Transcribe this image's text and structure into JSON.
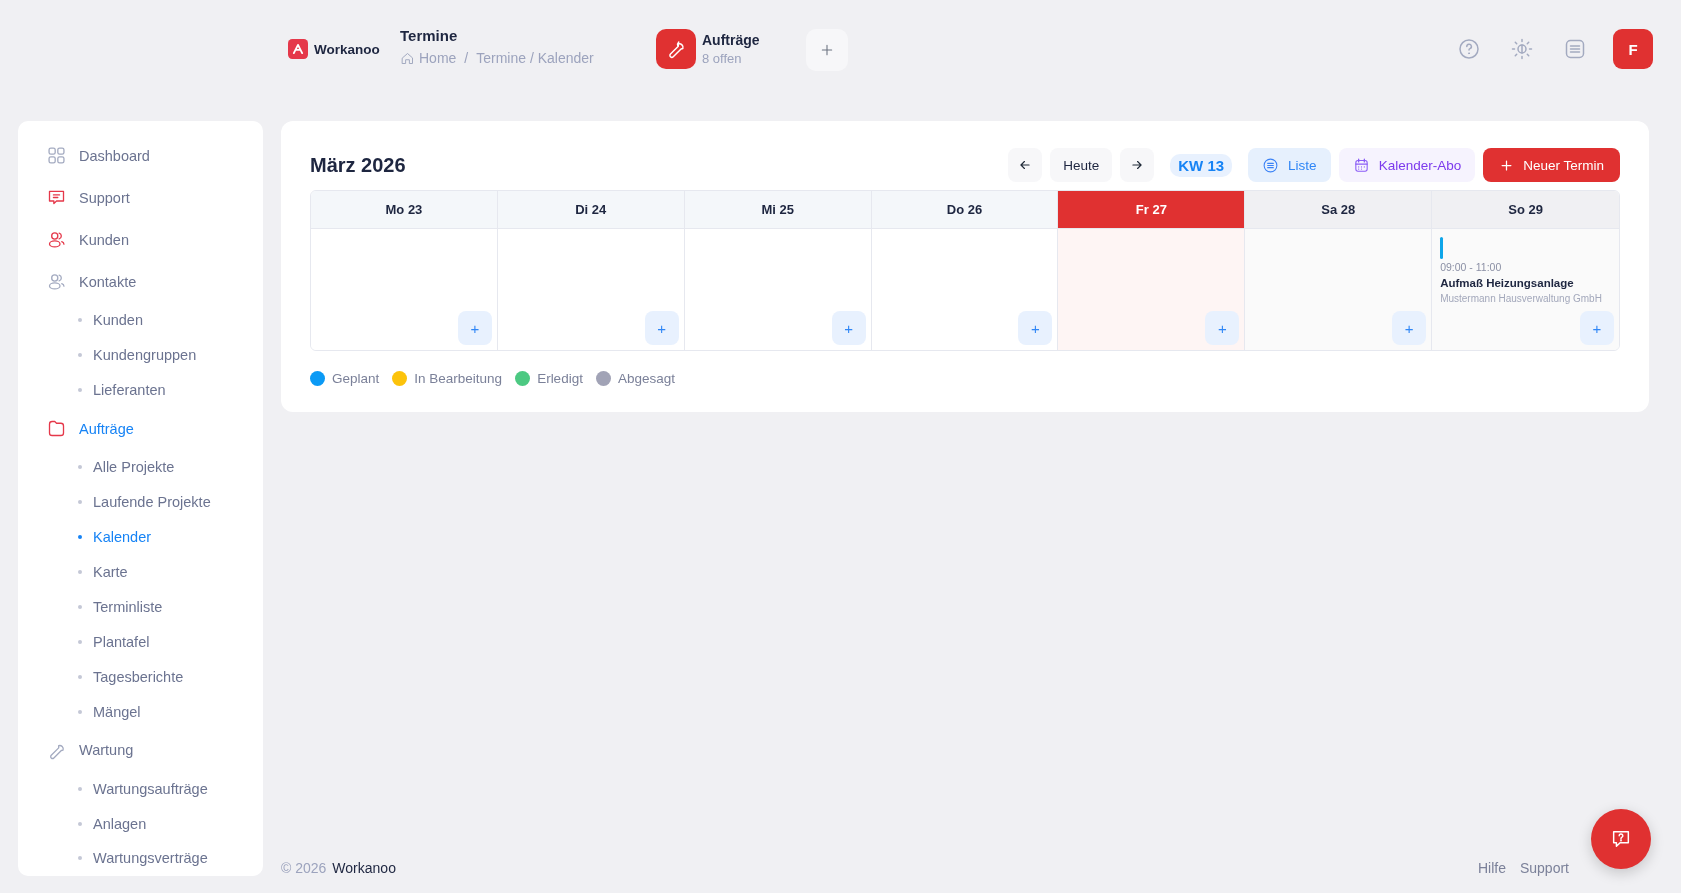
{
  "header": {
    "brand": "Workanoo",
    "page_title": "Termine",
    "breadcrumb": [
      "Home",
      "Termine / Kalender"
    ],
    "breadcrumb_separator": "/",
    "orders": {
      "title": "Aufträge",
      "subtitle": "8 offen"
    },
    "avatar": "F"
  },
  "sidebar": {
    "items": [
      {
        "label": "Dashboard",
        "selected": false
      },
      {
        "label": "Support",
        "selected": false
      },
      {
        "label": "Kunden",
        "selected": false
      },
      {
        "label": "Kontakte",
        "selected": false,
        "children": [
          {
            "label": "Kunden",
            "selected": false
          },
          {
            "label": "Kundengruppen",
            "selected": false
          },
          {
            "label": "Lieferanten",
            "selected": false
          }
        ]
      },
      {
        "label": "Aufträge",
        "selected": true,
        "children": [
          {
            "label": "Alle Projekte",
            "selected": false
          },
          {
            "label": "Laufende Projekte",
            "selected": false
          },
          {
            "label": "Kalender",
            "selected": true
          },
          {
            "label": "Karte",
            "selected": false
          },
          {
            "label": "Terminliste",
            "selected": false
          },
          {
            "label": "Plantafel",
            "selected": false
          },
          {
            "label": "Tagesberichte",
            "selected": false
          },
          {
            "label": "Mängel",
            "selected": false
          }
        ]
      },
      {
        "label": "Wartung",
        "selected": false,
        "children": [
          {
            "label": "Wartungsaufträge",
            "selected": false
          },
          {
            "label": "Anlagen",
            "selected": false
          },
          {
            "label": "Wartungsverträge",
            "selected": false
          }
        ]
      }
    ]
  },
  "calendar": {
    "title": "März 2026",
    "today_button": "Heute",
    "week": "KW 13",
    "list_button": "Liste",
    "subscribe_button": "Kalender-Abo",
    "new_button": "Neuer Termin",
    "days": [
      {
        "label": "Mo 23",
        "kind": "weekday",
        "add": "+"
      },
      {
        "label": "Di 24",
        "kind": "weekday",
        "add": "+"
      },
      {
        "label": "Mi 25",
        "kind": "weekday",
        "add": "+"
      },
      {
        "label": "Do 26",
        "kind": "weekday",
        "add": "+"
      },
      {
        "label": "Fr 27",
        "kind": "today",
        "add": "+"
      },
      {
        "label": "Sa 28",
        "kind": "weekend",
        "add": "+"
      },
      {
        "label": "So 29",
        "kind": "weekend",
        "add": "+",
        "events": [
          {
            "time": "09:00 - 11:00",
            "title": "Aufmaß Heizungsanlage",
            "customer": "Mustermann Hausverwaltung GmbH",
            "color": "#0ea5e9"
          }
        ]
      }
    ],
    "legend": [
      {
        "label": "Geplant",
        "color": "#0b9af5"
      },
      {
        "label": "In Bearbeitung",
        "color": "#fcc30b"
      },
      {
        "label": "Erledigt",
        "color": "#4cc982"
      },
      {
        "label": "Abgesagt",
        "color": "#a1a3b6"
      }
    ]
  },
  "footer": {
    "copyright": "© 2026",
    "brand": "Workanoo",
    "links": [
      "Hilfe",
      "Support"
    ]
  }
}
